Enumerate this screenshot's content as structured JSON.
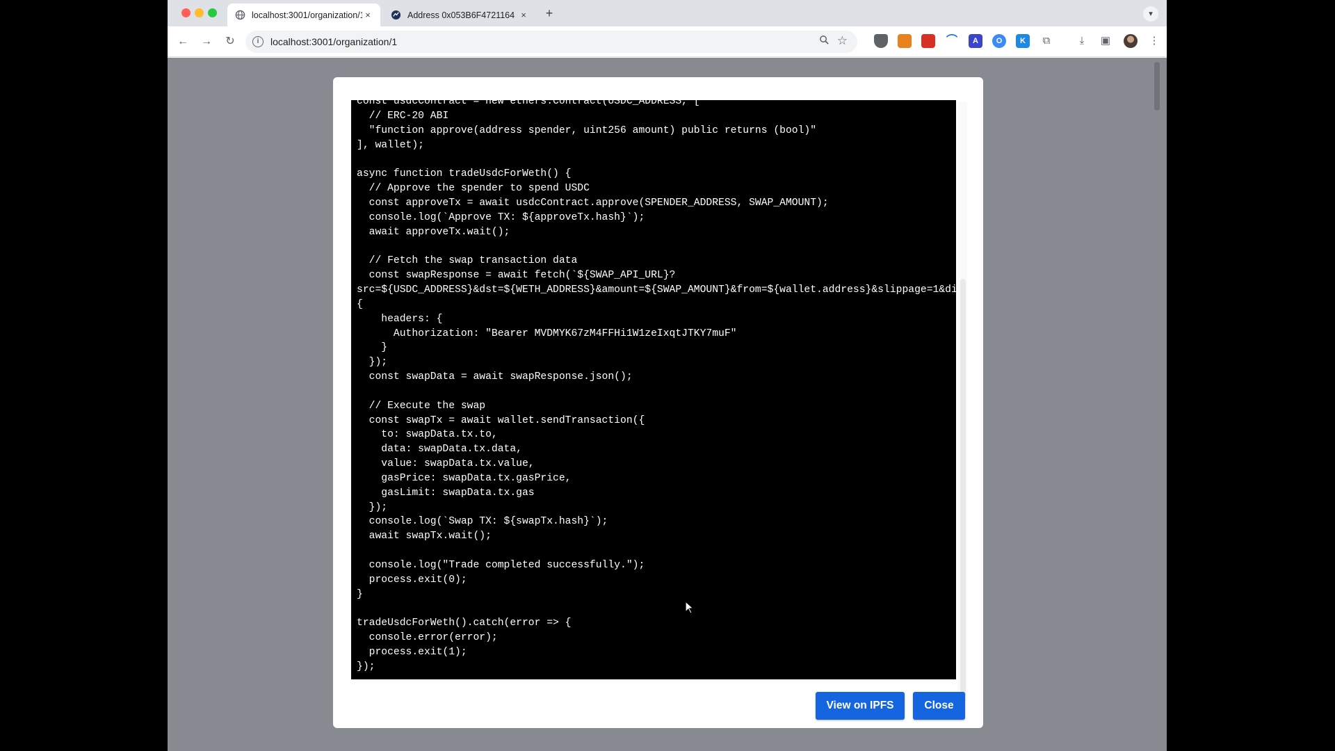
{
  "browser": {
    "tabs": [
      {
        "title": "localhost:3001/organization/1",
        "active": true,
        "icon": "globe-icon"
      },
      {
        "title": "Address 0x053B6F4721164",
        "active": false,
        "icon": "etherscan-icon"
      }
    ],
    "new_tab": "+",
    "tab_close": "×",
    "address_bar": {
      "url": "localhost:3001/organization/1"
    },
    "nav": {
      "back": "←",
      "forward": "→",
      "reload": "↻"
    },
    "extensions": [
      "shield-extension-icon",
      "metamask-extension-icon",
      "red-extension-icon",
      "arc-extension-icon",
      "a-extension-icon",
      "circle-extension-icon",
      "k-extension-icon",
      "puzzle-extension-icon"
    ]
  },
  "modal": {
    "code": "const usdcContract = new ethers.Contract(USDC_ADDRESS, [\n  // ERC-20 ABI\n  \"function approve(address spender, uint256 amount) public returns (bool)\"\n], wallet);\n\nasync function tradeUsdcForWeth() {\n  // Approve the spender to spend USDC\n  const approveTx = await usdcContract.approve(SPENDER_ADDRESS, SWAP_AMOUNT);\n  console.log(`Approve TX: ${approveTx.hash}`);\n  await approveTx.wait();\n\n  // Fetch the swap transaction data\n  const swapResponse = await fetch(`${SWAP_API_URL}?\nsrc=${USDC_ADDRESS}&dst=${WETH_ADDRESS}&amount=${SWAP_AMOUNT}&from=${wallet.address}&slippage=1&di\n{\n    headers: {\n      Authorization: \"Bearer MVDMYK67zM4FFHi1W1zeIxqtJTKY7muF\"\n    }\n  });\n  const swapData = await swapResponse.json();\n\n  // Execute the swap\n  const swapTx = await wallet.sendTransaction({\n    to: swapData.tx.to,\n    data: swapData.tx.data,\n    value: swapData.tx.value,\n    gasPrice: swapData.tx.gasPrice,\n    gasLimit: swapData.tx.gas\n  });\n  console.log(`Swap TX: ${swapTx.hash}`);\n  await swapTx.wait();\n\n  console.log(\"Trade completed successfully.\");\n  process.exit(0);\n}\n\ntradeUsdcForWeth().catch(error => {\n  console.error(error);\n  process.exit(1);\n});",
    "buttons": {
      "view_ipfs": "View on IPFS",
      "close": "Close"
    }
  },
  "colors": {
    "primary_button": "#1565e0",
    "code_bg": "#000000",
    "overlay": "#878a91"
  }
}
